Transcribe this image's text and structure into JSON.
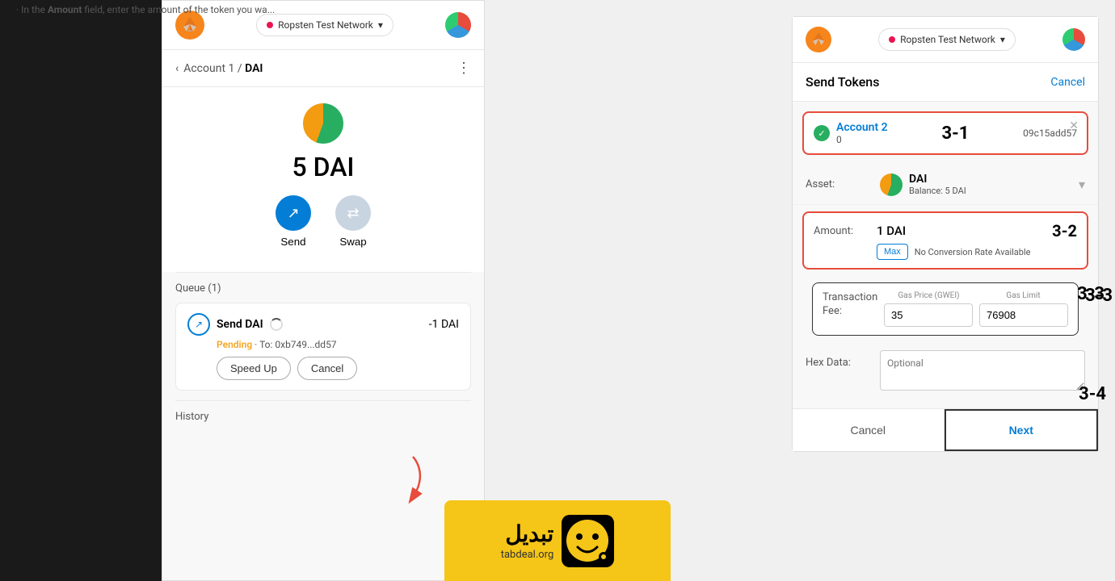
{
  "left": {
    "header": {
      "network": "Ropsten Test Network",
      "network_dot_color": "#e91550"
    },
    "account_bar": {
      "back_text": "<",
      "account_label": "Account 1",
      "dai_label": "DAI"
    },
    "balance": {
      "amount": "5 DAI"
    },
    "actions": {
      "send_label": "Send",
      "swap_label": "Swap"
    },
    "queue": {
      "title": "Queue (1)",
      "transaction": {
        "name": "Send DAI",
        "status": "Pending",
        "to": "To: 0xb749...dd57",
        "amount": "-1 DAI",
        "speed_up_label": "Speed Up",
        "cancel_label": "Cancel"
      }
    },
    "history": {
      "title": "History"
    }
  },
  "right": {
    "instruction": "In the Amount field, enter the amount of the token you wa...",
    "amount_bold": "Amount",
    "header": {
      "network": "Ropsten Test Network"
    },
    "send_tokens": {
      "title": "Send Tokens",
      "cancel_label": "Cancel"
    },
    "account2": {
      "name": "Account 2",
      "balance": "0",
      "address": "09c15add57",
      "step_label": "3-1"
    },
    "asset": {
      "label": "Asset:",
      "name": "DAI",
      "balance": "Balance: 5 DAI"
    },
    "amount_section": {
      "label": "Amount:",
      "value": "1 DAI",
      "step_label": "3-2",
      "max_label": "Max",
      "no_conversion": "No Conversion Rate Available"
    },
    "tx_fee": {
      "label": "Transaction Fee:",
      "gas_price_label": "Gas Price (GWEI)",
      "gas_limit_label": "Gas Limit",
      "gas_price": "35",
      "gas_limit": "76908",
      "step_label": "3-3"
    },
    "hex_data": {
      "label": "Hex Data:",
      "placeholder": "Optional"
    },
    "buttons": {
      "cancel_label": "Cancel",
      "next_label": "Next",
      "step_label": "3-4"
    }
  },
  "tabdeal": {
    "fa_text": "تبدیل",
    "en_text": "tabdeal.org"
  }
}
